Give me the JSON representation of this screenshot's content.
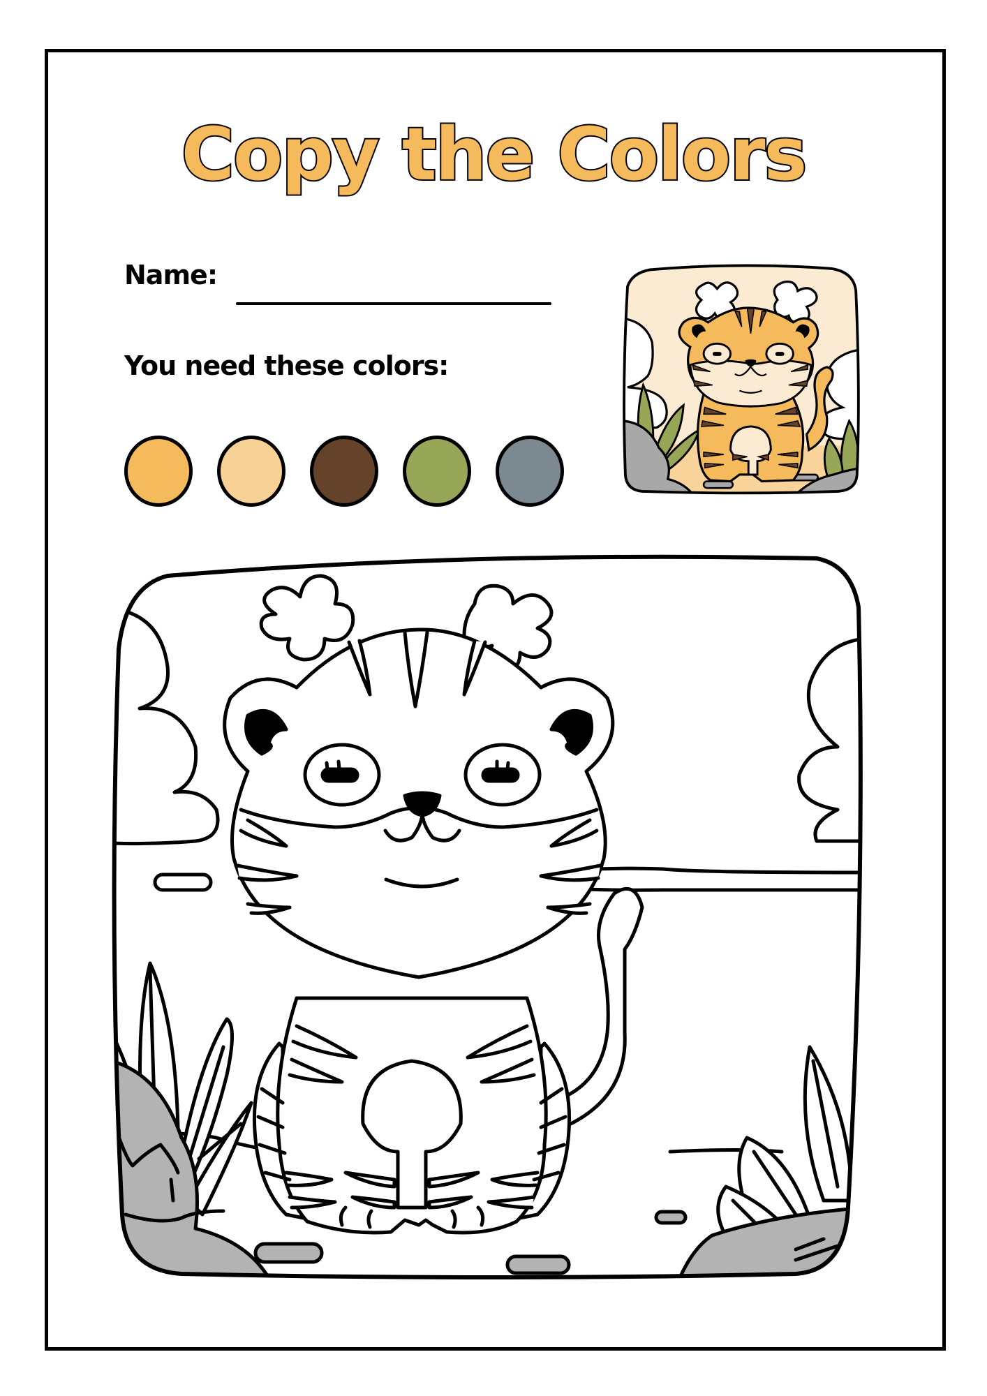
{
  "worksheet": {
    "title": "Copy the Colors",
    "name_label": "Name:",
    "colors_label": "You need these colors:",
    "palette": [
      {
        "name": "orange",
        "hex": "#F4BA5C"
      },
      {
        "name": "light-peach",
        "hex": "#F7D195"
      },
      {
        "name": "brown",
        "hex": "#65432A"
      },
      {
        "name": "olive-green",
        "hex": "#97A757"
      },
      {
        "name": "slate-gray",
        "hex": "#7C8991"
      }
    ],
    "reference_image": {
      "subject": "tiger",
      "colors": {
        "sky": "#FCEBD3",
        "ground": "#F8D49A",
        "tiger": "#F4BA5C",
        "stripes": "#65432A",
        "leaves": "#97A757",
        "rocks": "#A8A8A8",
        "clouds": "#FFFFFF"
      }
    },
    "coloring_image": {
      "subject": "tiger",
      "rock_fill": "#B3B3B3"
    }
  }
}
